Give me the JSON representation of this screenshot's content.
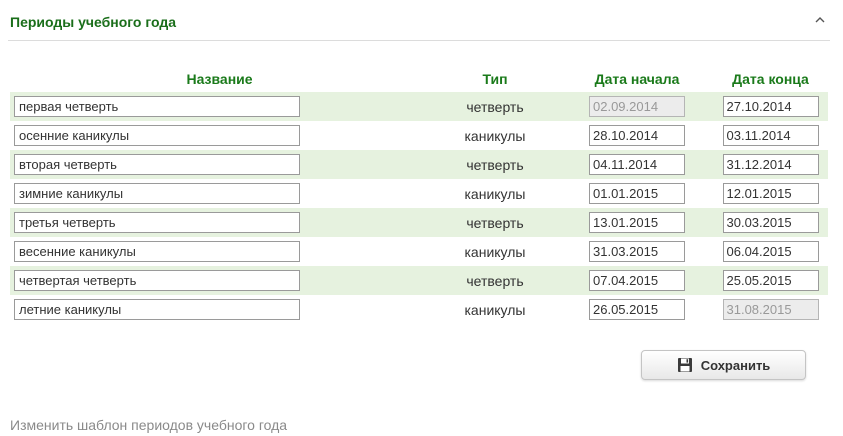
{
  "panel": {
    "title": "Периоды учебного года"
  },
  "table": {
    "columns": {
      "name": "Название",
      "type": "Тип",
      "start": "Дата начала",
      "end": "Дата конца"
    },
    "rows": [
      {
        "name": "первая четверть",
        "type": "четверть",
        "start": "02.09.2014",
        "end": "27.10.2014",
        "start_disabled": true,
        "end_disabled": false
      },
      {
        "name": "осенние каникулы",
        "type": "каникулы",
        "start": "28.10.2014",
        "end": "03.11.2014",
        "start_disabled": false,
        "end_disabled": false
      },
      {
        "name": "вторая четверть",
        "type": "четверть",
        "start": "04.11.2014",
        "end": "31.12.2014",
        "start_disabled": false,
        "end_disabled": false
      },
      {
        "name": "зимние каникулы",
        "type": "каникулы",
        "start": "01.01.2015",
        "end": "12.01.2015",
        "start_disabled": false,
        "end_disabled": false
      },
      {
        "name": "третья четверть",
        "type": "четверть",
        "start": "13.01.2015",
        "end": "30.03.2015",
        "start_disabled": false,
        "end_disabled": false
      },
      {
        "name": "весенние каникулы",
        "type": "каникулы",
        "start": "31.03.2015",
        "end": "06.04.2015",
        "start_disabled": false,
        "end_disabled": false
      },
      {
        "name": "четвертая четверть",
        "type": "четверть",
        "start": "07.04.2015",
        "end": "25.05.2015",
        "start_disabled": false,
        "end_disabled": false
      },
      {
        "name": "летние каникулы",
        "type": "каникулы",
        "start": "26.05.2015",
        "end": "31.08.2015",
        "start_disabled": false,
        "end_disabled": true
      }
    ]
  },
  "actions": {
    "save_label": "Сохранить",
    "save_icon": "floppy-disk-icon",
    "collapse_icon": "chevron-up-icon",
    "template_link": "Изменить шаблон периодов учебного года"
  },
  "colors": {
    "accent": "#1a6e1a",
    "row_stripe": "#e6f2df",
    "link": "#8a8a8a"
  }
}
